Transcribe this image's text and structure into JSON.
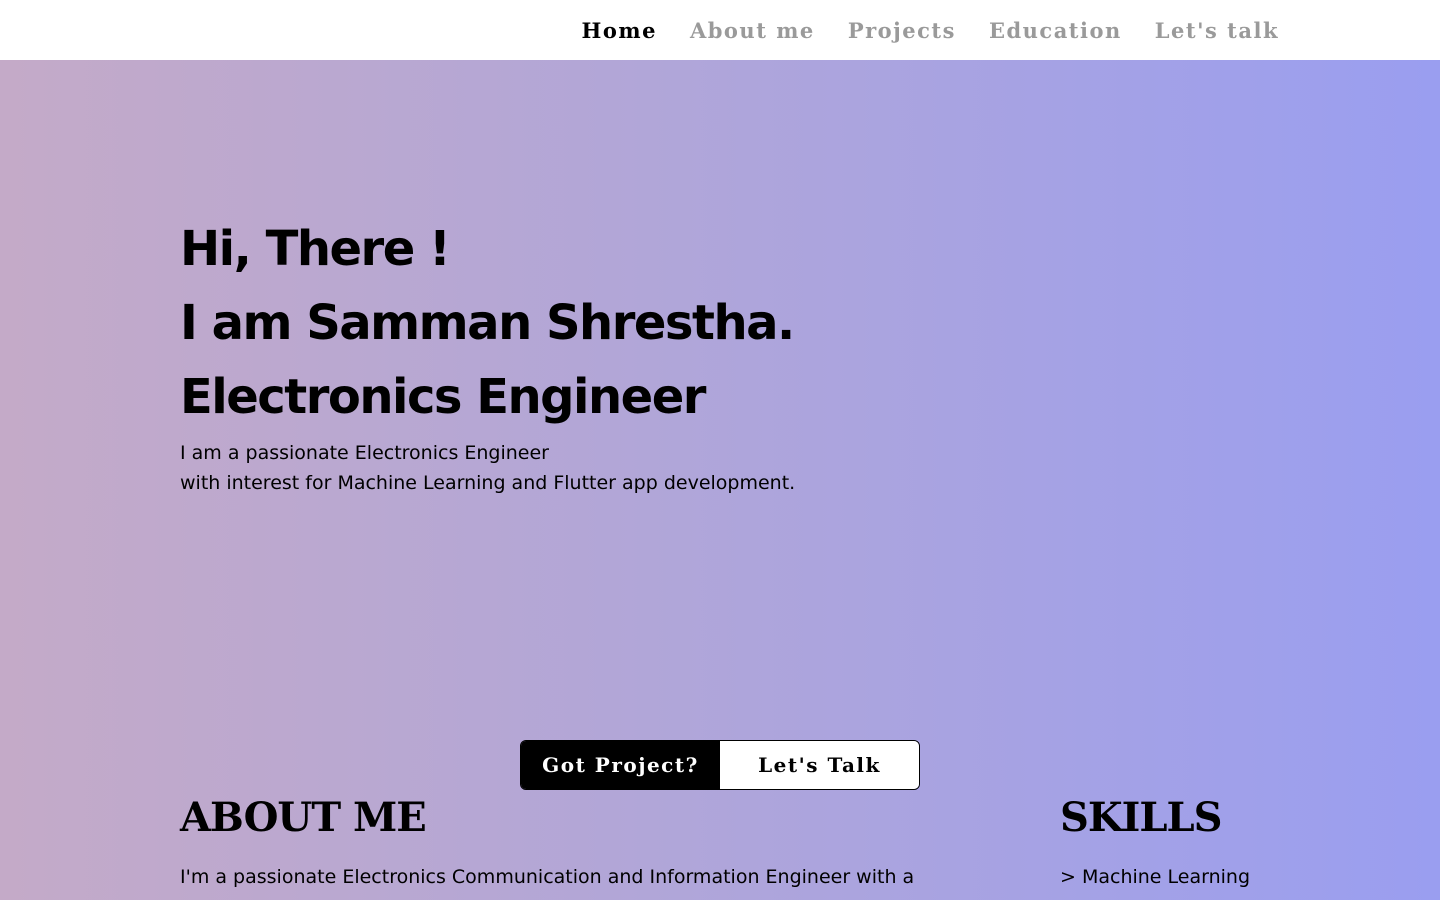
{
  "nav": {
    "items": [
      {
        "label": "Home",
        "active": true
      },
      {
        "label": "About me",
        "active": false
      },
      {
        "label": "Projects",
        "active": false
      },
      {
        "label": "Education",
        "active": false
      },
      {
        "label": "Let's talk",
        "active": false
      }
    ]
  },
  "hero": {
    "greeting": "Hi, There !",
    "name_line": "I am Samman Shrestha.",
    "role": "Electronics Engineer",
    "description": [
      "I am a passionate Electronics Engineer",
      "with interest for Machine Learning and Flutter app development."
    ]
  },
  "cta": {
    "primary_label": "Got Project?",
    "secondary_label": "Let's Talk"
  },
  "about": {
    "title": "ABOUT ME",
    "text": "I'm a passionate Electronics Communication and Information Engineer with a"
  },
  "skills": {
    "title": "SKILLS",
    "items": [
      "> Machine Learning"
    ]
  },
  "colors": {
    "gradient_start": "#c4aac8",
    "gradient_end": "#9a9ef0",
    "nav_inactive": "#9a9a9a",
    "nav_active": "#000000"
  }
}
